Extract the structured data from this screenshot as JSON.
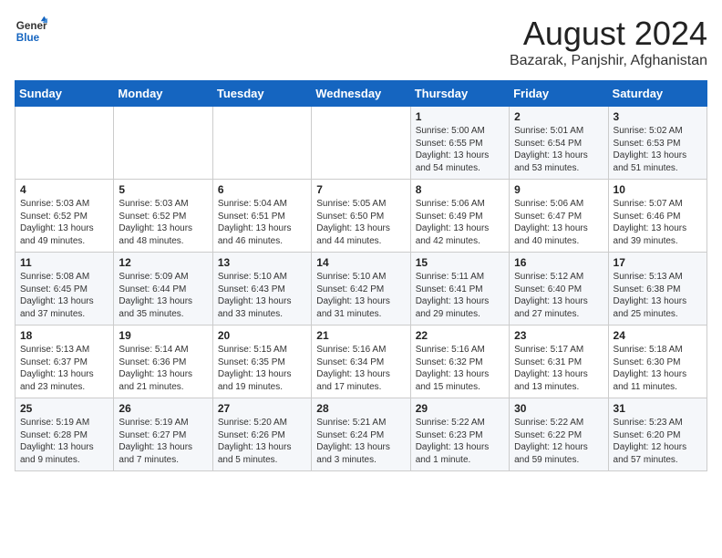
{
  "logo": {
    "line1": "General",
    "line2": "Blue"
  },
  "title": "August 2024",
  "subtitle": "Bazarak, Panjshir, Afghanistan",
  "days_of_week": [
    "Sunday",
    "Monday",
    "Tuesday",
    "Wednesday",
    "Thursday",
    "Friday",
    "Saturday"
  ],
  "weeks": [
    [
      {
        "day": "",
        "info": ""
      },
      {
        "day": "",
        "info": ""
      },
      {
        "day": "",
        "info": ""
      },
      {
        "day": "",
        "info": ""
      },
      {
        "day": "1",
        "info": "Sunrise: 5:00 AM\nSunset: 6:55 PM\nDaylight: 13 hours\nand 54 minutes."
      },
      {
        "day": "2",
        "info": "Sunrise: 5:01 AM\nSunset: 6:54 PM\nDaylight: 13 hours\nand 53 minutes."
      },
      {
        "day": "3",
        "info": "Sunrise: 5:02 AM\nSunset: 6:53 PM\nDaylight: 13 hours\nand 51 minutes."
      }
    ],
    [
      {
        "day": "4",
        "info": "Sunrise: 5:03 AM\nSunset: 6:52 PM\nDaylight: 13 hours\nand 49 minutes."
      },
      {
        "day": "5",
        "info": "Sunrise: 5:03 AM\nSunset: 6:52 PM\nDaylight: 13 hours\nand 48 minutes."
      },
      {
        "day": "6",
        "info": "Sunrise: 5:04 AM\nSunset: 6:51 PM\nDaylight: 13 hours\nand 46 minutes."
      },
      {
        "day": "7",
        "info": "Sunrise: 5:05 AM\nSunset: 6:50 PM\nDaylight: 13 hours\nand 44 minutes."
      },
      {
        "day": "8",
        "info": "Sunrise: 5:06 AM\nSunset: 6:49 PM\nDaylight: 13 hours\nand 42 minutes."
      },
      {
        "day": "9",
        "info": "Sunrise: 5:06 AM\nSunset: 6:47 PM\nDaylight: 13 hours\nand 40 minutes."
      },
      {
        "day": "10",
        "info": "Sunrise: 5:07 AM\nSunset: 6:46 PM\nDaylight: 13 hours\nand 39 minutes."
      }
    ],
    [
      {
        "day": "11",
        "info": "Sunrise: 5:08 AM\nSunset: 6:45 PM\nDaylight: 13 hours\nand 37 minutes."
      },
      {
        "day": "12",
        "info": "Sunrise: 5:09 AM\nSunset: 6:44 PM\nDaylight: 13 hours\nand 35 minutes."
      },
      {
        "day": "13",
        "info": "Sunrise: 5:10 AM\nSunset: 6:43 PM\nDaylight: 13 hours\nand 33 minutes."
      },
      {
        "day": "14",
        "info": "Sunrise: 5:10 AM\nSunset: 6:42 PM\nDaylight: 13 hours\nand 31 minutes."
      },
      {
        "day": "15",
        "info": "Sunrise: 5:11 AM\nSunset: 6:41 PM\nDaylight: 13 hours\nand 29 minutes."
      },
      {
        "day": "16",
        "info": "Sunrise: 5:12 AM\nSunset: 6:40 PM\nDaylight: 13 hours\nand 27 minutes."
      },
      {
        "day": "17",
        "info": "Sunrise: 5:13 AM\nSunset: 6:38 PM\nDaylight: 13 hours\nand 25 minutes."
      }
    ],
    [
      {
        "day": "18",
        "info": "Sunrise: 5:13 AM\nSunset: 6:37 PM\nDaylight: 13 hours\nand 23 minutes."
      },
      {
        "day": "19",
        "info": "Sunrise: 5:14 AM\nSunset: 6:36 PM\nDaylight: 13 hours\nand 21 minutes."
      },
      {
        "day": "20",
        "info": "Sunrise: 5:15 AM\nSunset: 6:35 PM\nDaylight: 13 hours\nand 19 minutes."
      },
      {
        "day": "21",
        "info": "Sunrise: 5:16 AM\nSunset: 6:34 PM\nDaylight: 13 hours\nand 17 minutes."
      },
      {
        "day": "22",
        "info": "Sunrise: 5:16 AM\nSunset: 6:32 PM\nDaylight: 13 hours\nand 15 minutes."
      },
      {
        "day": "23",
        "info": "Sunrise: 5:17 AM\nSunset: 6:31 PM\nDaylight: 13 hours\nand 13 minutes."
      },
      {
        "day": "24",
        "info": "Sunrise: 5:18 AM\nSunset: 6:30 PM\nDaylight: 13 hours\nand 11 minutes."
      }
    ],
    [
      {
        "day": "25",
        "info": "Sunrise: 5:19 AM\nSunset: 6:28 PM\nDaylight: 13 hours\nand 9 minutes."
      },
      {
        "day": "26",
        "info": "Sunrise: 5:19 AM\nSunset: 6:27 PM\nDaylight: 13 hours\nand 7 minutes."
      },
      {
        "day": "27",
        "info": "Sunrise: 5:20 AM\nSunset: 6:26 PM\nDaylight: 13 hours\nand 5 minutes."
      },
      {
        "day": "28",
        "info": "Sunrise: 5:21 AM\nSunset: 6:24 PM\nDaylight: 13 hours\nand 3 minutes."
      },
      {
        "day": "29",
        "info": "Sunrise: 5:22 AM\nSunset: 6:23 PM\nDaylight: 13 hours\nand 1 minute."
      },
      {
        "day": "30",
        "info": "Sunrise: 5:22 AM\nSunset: 6:22 PM\nDaylight: 12 hours\nand 59 minutes."
      },
      {
        "day": "31",
        "info": "Sunrise: 5:23 AM\nSunset: 6:20 PM\nDaylight: 12 hours\nand 57 minutes."
      }
    ]
  ]
}
